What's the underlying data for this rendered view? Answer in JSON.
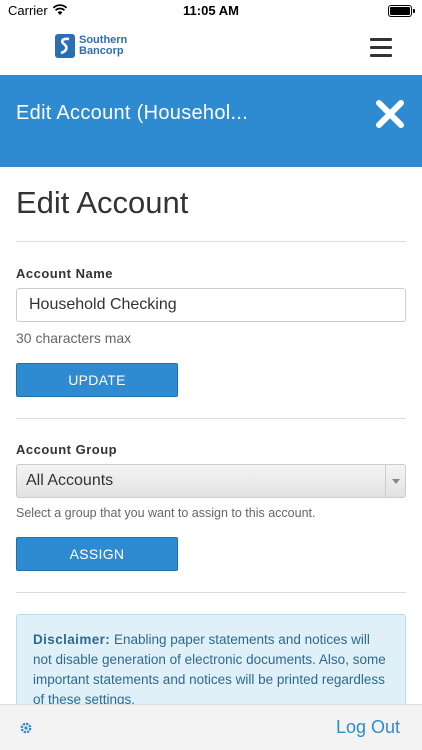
{
  "status_bar": {
    "carrier": "Carrier",
    "time": "11:05 AM"
  },
  "header": {
    "logo_line1": "Southern",
    "logo_line2": "Bancorp"
  },
  "title_bar": {
    "title": "Edit Account (Househol..."
  },
  "page": {
    "heading": "Edit Account",
    "account_name": {
      "label": "Account Name",
      "value": "Household Checking",
      "help": "30 characters max",
      "button": "UPDATE"
    },
    "account_group": {
      "label": "Account Group",
      "selected": "All Accounts",
      "help": "Select a group that you want to assign to this account.",
      "button": "ASSIGN"
    },
    "disclaimer": {
      "label": "Disclaimer:",
      "text": "Enabling paper statements and notices will not disable generation of electronic documents. Also, some important statements and notices will be printed regardless of these settings."
    }
  },
  "bottom_bar": {
    "logout": "Log Out"
  },
  "colors": {
    "primary": "#2e8bd1",
    "disclaimer_bg": "#dff0f8",
    "disclaimer_text": "#2d6a8f"
  }
}
